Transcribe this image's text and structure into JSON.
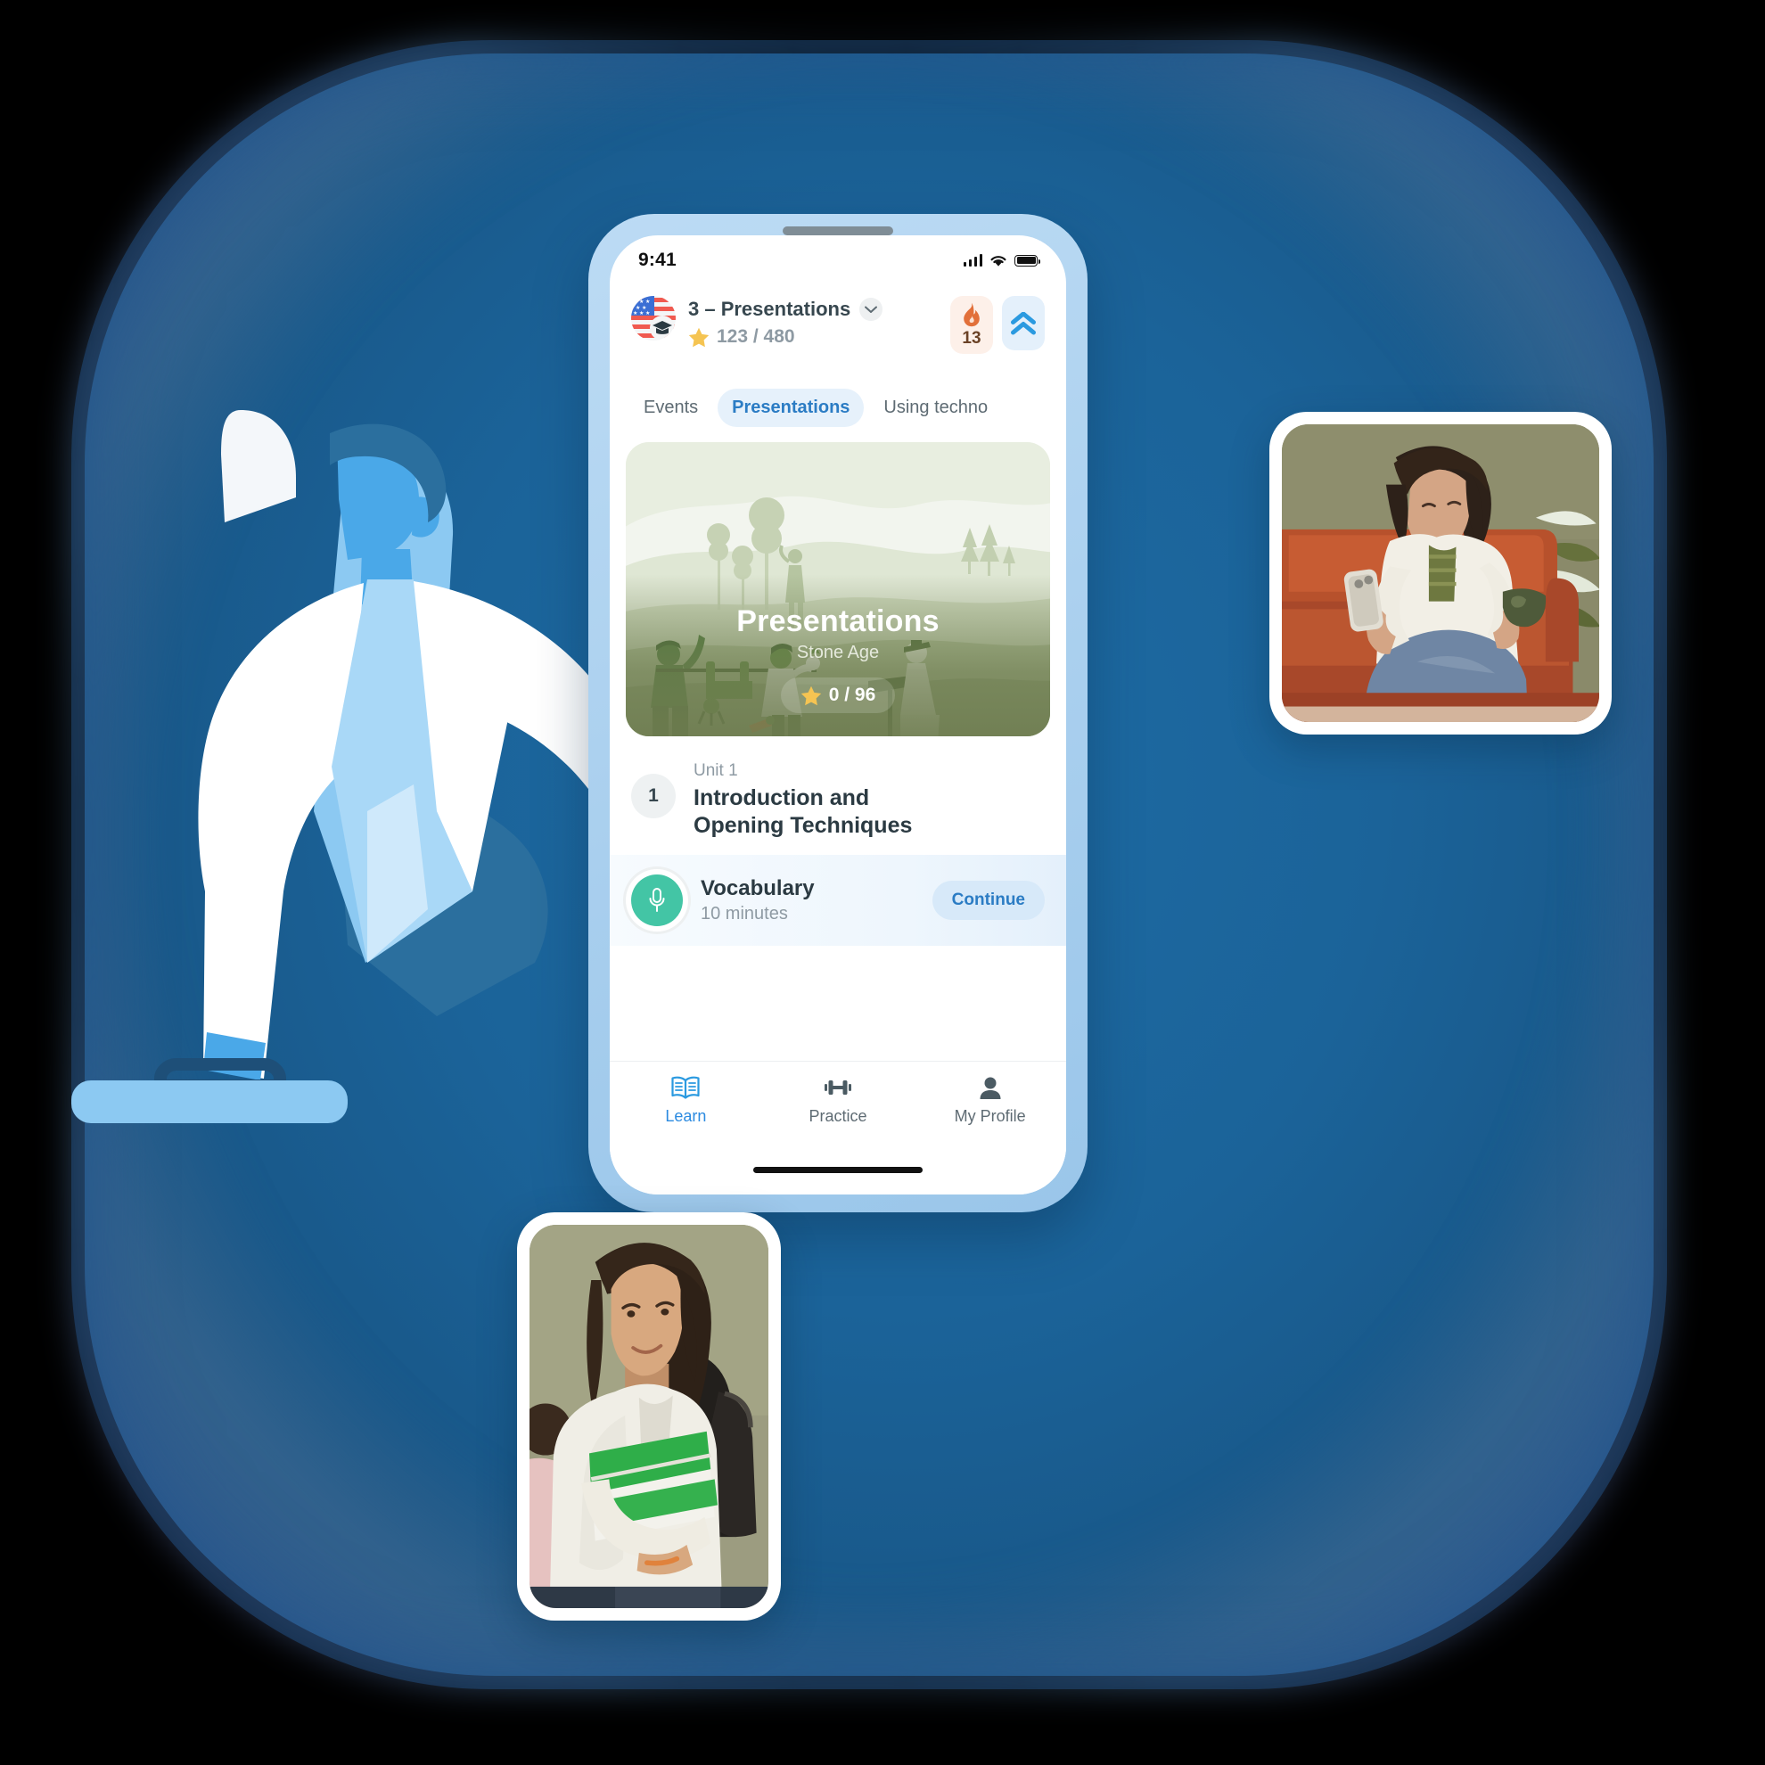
{
  "status_bar": {
    "time": "9:41",
    "icons": [
      "cellular-signal-icon",
      "wifi-icon",
      "battery-icon"
    ]
  },
  "app_header": {
    "avatar_icon": "us-flag-graduation-cap-avatar",
    "course_title": "3 – Presentations",
    "dropdown_icon": "chevron-down-icon",
    "xp_icon": "star-icon",
    "xp_text": "123 / 480",
    "badges": [
      {
        "name": "streak-badge",
        "icon": "flame-icon",
        "value": "13",
        "bg": "#fdf0e9",
        "accent": "#e2703a"
      },
      {
        "name": "level-badge",
        "icon": "double-chevron-up-icon",
        "value": "",
        "bg": "#e4f0fb",
        "accent": "#2b9ae0"
      }
    ]
  },
  "tabs": [
    {
      "label": "Events",
      "active": false
    },
    {
      "label": "Presentations",
      "active": true
    },
    {
      "label": "Using techno",
      "active": false
    }
  ],
  "hero_card": {
    "title": "Presentations",
    "subtitle": "Stone Age",
    "progress_icon": "star-icon",
    "progress_text": "0 / 96",
    "illustration": "stone-age-presentation-scene"
  },
  "unit": {
    "label": "Unit 1",
    "number": "1",
    "title": "Introduction and\nOpening Techniques"
  },
  "lesson": {
    "icon": "microphone-icon",
    "title": "Vocabulary",
    "duration": "10 minutes",
    "action_label": "Continue"
  },
  "bottom_nav": [
    {
      "label": "Learn",
      "icon": "open-book-icon",
      "active": true
    },
    {
      "label": "Practice",
      "icon": "dumbbell-icon",
      "active": false
    },
    {
      "label": "My Profile",
      "icon": "person-icon",
      "active": false
    }
  ],
  "photos": [
    {
      "name": "woman-on-couch-with-phone-photo",
      "alt": "Woman sitting on an orange leather couch looking at her phone and holding a mug"
    },
    {
      "name": "student-with-notebook-photo",
      "alt": "Smiling student with backpack holding a green notebook"
    }
  ],
  "background": {
    "illustration": "businessman-with-briefcase-illustration",
    "blob_color": "#1a5a8c"
  },
  "colors": {
    "brand_blue": "#2b8ae0",
    "tab_active_bg": "#e6f1fb",
    "hero_green": "#6e7c50",
    "lesson_accent": "#43c5a5",
    "streak_orange": "#e2703a",
    "star_yellow": "#f5c452"
  }
}
